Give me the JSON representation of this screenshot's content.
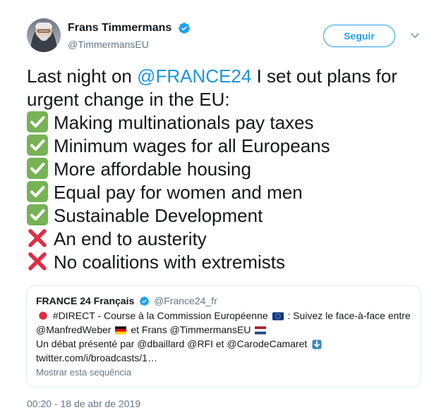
{
  "author": {
    "display_name": "Frans Timmermans",
    "handle": "@TimmermansEU",
    "verified_icon": "verified-badge-icon"
  },
  "follow_button": {
    "label": "Seguir"
  },
  "tweet": {
    "intro_before_mention": "Last night on ",
    "mention": "@FRANCE24",
    "intro_after_mention": " I set out plans for urgent change in the EU:",
    "items": [
      {
        "icon": "check-mark-button-icon",
        "text": "Making multinationals pay taxes"
      },
      {
        "icon": "check-mark-button-icon",
        "text": "Minimum wages for all Europeans"
      },
      {
        "icon": "check-mark-button-icon",
        "text": "More affordable housing"
      },
      {
        "icon": "check-mark-button-icon",
        "text": "Equal pay for women and men"
      },
      {
        "icon": "check-mark-button-icon",
        "text": "Sustainable Development"
      },
      {
        "icon": "cross-mark-icon",
        "text": "An end to austerity"
      },
      {
        "icon": "cross-mark-icon",
        "text": "No coalitions with extremists"
      }
    ]
  },
  "quoted_tweet": {
    "display_name": "FRANCE 24 Français",
    "handle": "@France24_fr",
    "line1_a": "#DIRECT - Course à la Commission Européenne",
    "line1_b": ": Suivez le face-à-face entre",
    "line2_a": "@ManfredWeber",
    "line2_b": "et Frans @TimmermansEU",
    "line3": "Un débat présenté par @dbaillard @RFI et @CarodeCamaret",
    "line4": "twitter.com/i/broadcasts/1…",
    "show_thread": "Mostrar esta sequência"
  },
  "timestamp": "00:20 - 18 de abr de 2019",
  "colors": {
    "accent": "#1da1f2",
    "link": "#1b95e0",
    "muted": "#657786",
    "check_green": "#77b255",
    "cross_red": "#dd2e44"
  }
}
